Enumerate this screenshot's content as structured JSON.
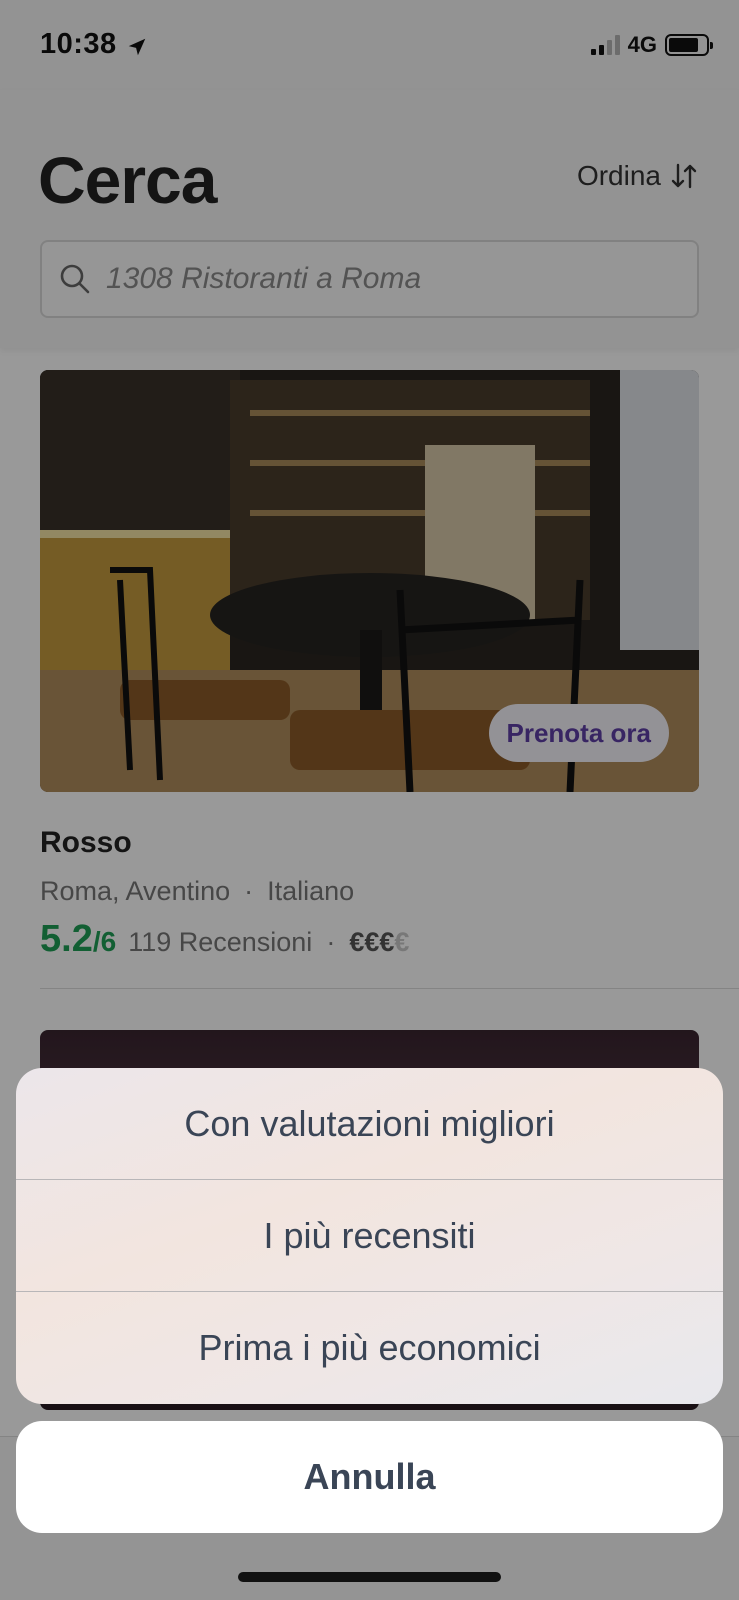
{
  "status_bar": {
    "time": "10:38",
    "network": "4G"
  },
  "header": {
    "title": "Cerca",
    "sort_label": "Ordina",
    "search_placeholder": "1308 Ristoranti a Roma"
  },
  "restaurant": {
    "name": "Rosso",
    "location": "Roma, Aventino",
    "cuisine": "Italiano",
    "score": "5.2",
    "score_max": "/6",
    "reviews": "119 Recensioni",
    "price_active": "€€€",
    "price_inactive": "€",
    "book_label": "Prenota ora"
  },
  "action_sheet": {
    "options": [
      "Con valutazioni migliori",
      "I più recensiti",
      "Prima i più economici"
    ],
    "cancel_label": "Annulla"
  },
  "colors": {
    "score_green": "#1e9e55",
    "book_purple": "#5e3fa6",
    "sheet_text": "#3a4556"
  }
}
